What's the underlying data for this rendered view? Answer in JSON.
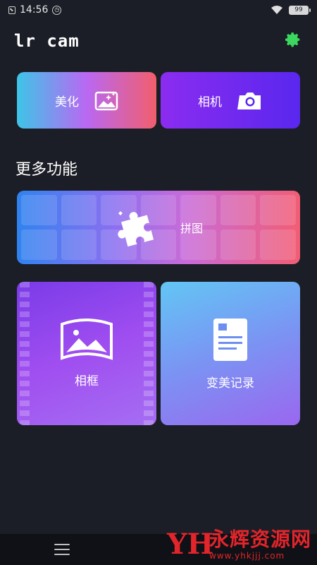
{
  "status_bar": {
    "time": "14:56",
    "battery": "99"
  },
  "app": {
    "title": "lr cam"
  },
  "cards": {
    "beauty_label": "美化",
    "camera_label": "相机",
    "puzzle_label": "拼图",
    "frame_label": "相框",
    "record_label": "变美记录"
  },
  "section": {
    "more_features": "更多功能"
  },
  "watermark": {
    "title": "永辉资源网",
    "url": "www.yhkjjj.com"
  },
  "colors": {
    "accent_green": "#3bd75e",
    "background": "#1b1e26",
    "watermark_red": "#e2252b"
  }
}
